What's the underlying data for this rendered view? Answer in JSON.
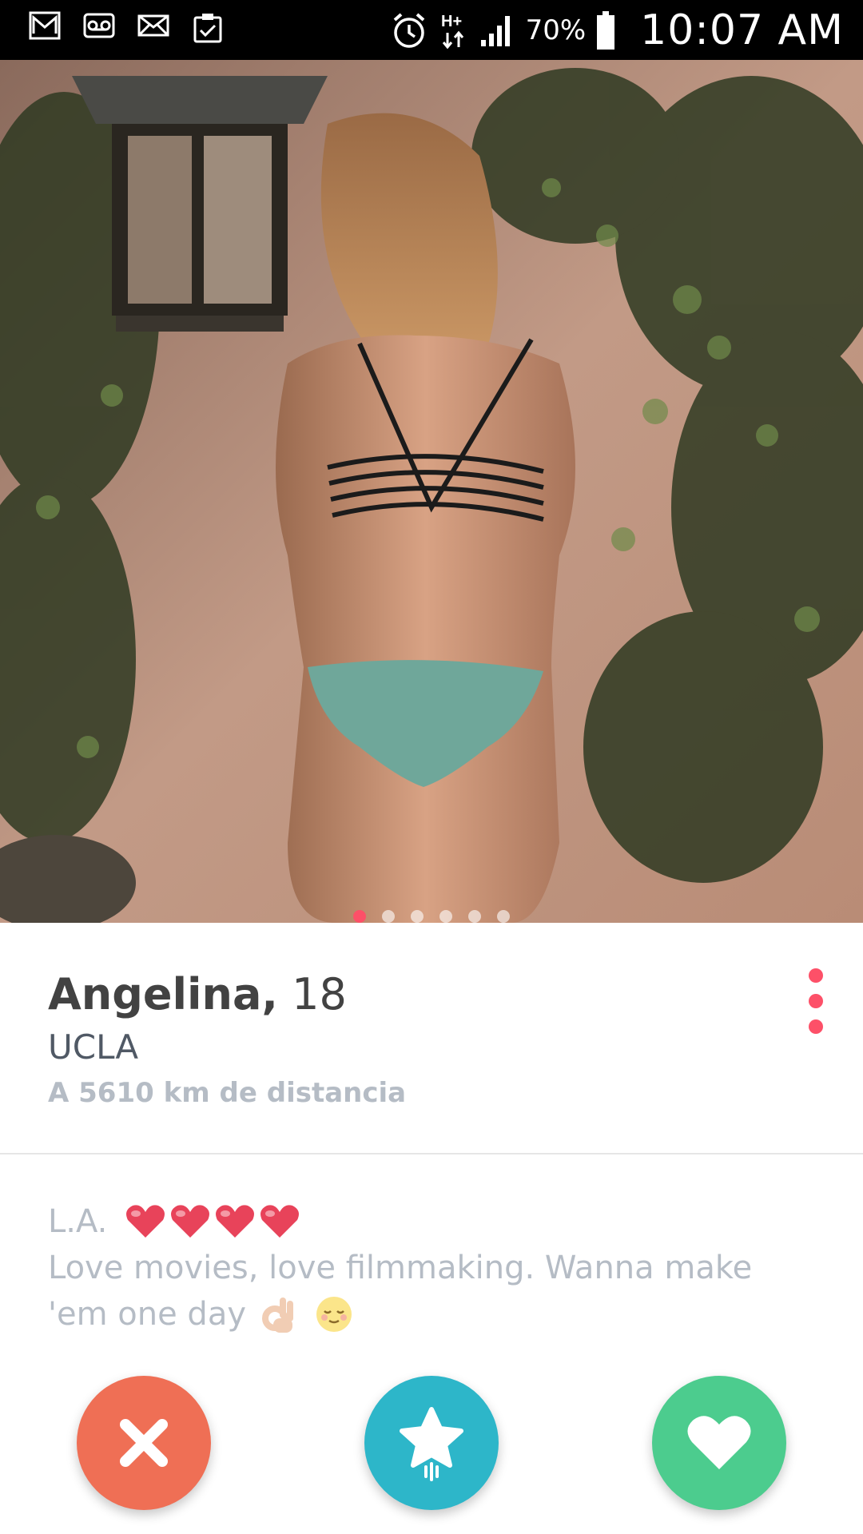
{
  "status_bar": {
    "icons_left": [
      "gmail-icon",
      "voicemail-icon",
      "mail-icon",
      "clipboard-icon"
    ],
    "icons_right": [
      "alarm-icon",
      "network-hplus-icon",
      "signal-icon",
      "battery-icon"
    ],
    "network_type": "H+",
    "battery_percent": "70%",
    "time": "10:07 AM"
  },
  "profile": {
    "photo_index": 1,
    "photo_count": 6,
    "name": "Angelina,",
    "age": "18",
    "school": "UCLA",
    "distance": "A 5610 km de distancia"
  },
  "bio": {
    "line1": "L.A.",
    "hearts_count": 4,
    "text": "Love movies, love filmmaking. Wanna make",
    "text2": "'em one day",
    "emojis": [
      "ok-hand-emoji",
      "relieved-face-emoji"
    ]
  },
  "actions": {
    "nope": "close-icon",
    "super_like": "star-icon",
    "like": "heart-icon"
  },
  "colors": {
    "accent": "#fd5068",
    "nope": "#ef6f55",
    "super_like": "#2db6c9",
    "like": "#4ccc8e"
  }
}
